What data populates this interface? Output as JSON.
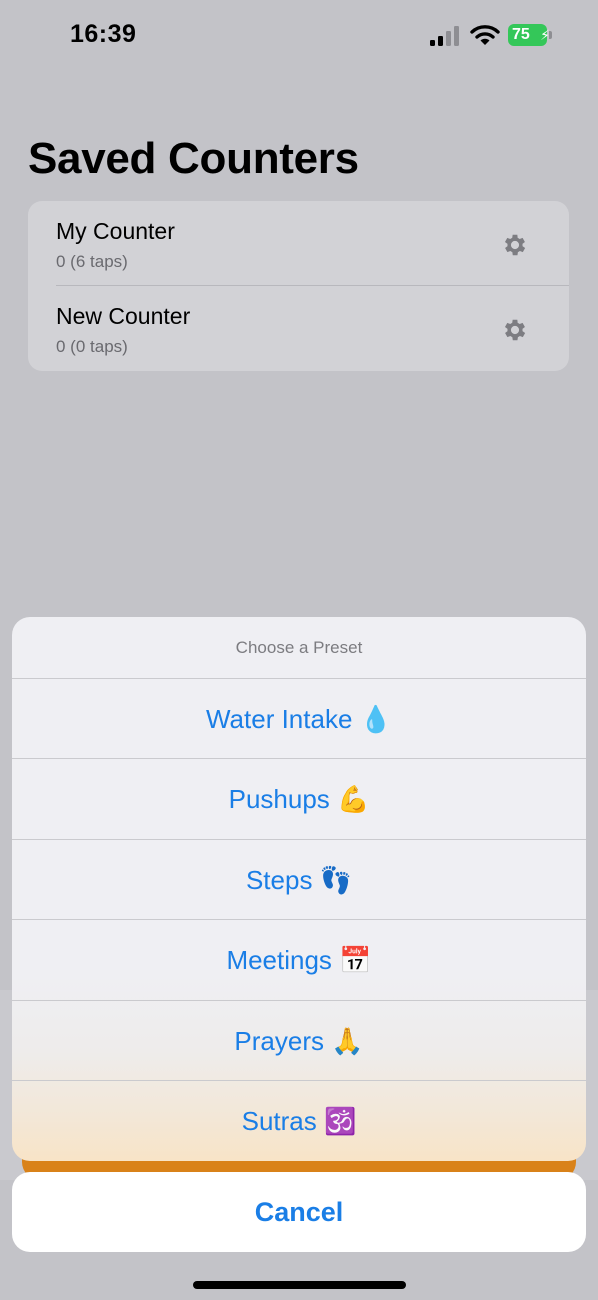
{
  "status_bar": {
    "time": "16:39",
    "battery_level": "75",
    "battery_charging_glyph": "⚡"
  },
  "page": {
    "title": "Saved Counters"
  },
  "counters": [
    {
      "name": "My Counter",
      "subtitle": "0 (6 taps)",
      "icon": "gear-icon"
    },
    {
      "name": "New Counter",
      "subtitle": "0 (0 taps)",
      "icon": "gear-icon"
    }
  ],
  "action_sheet": {
    "title": "Choose a Preset",
    "options": [
      {
        "label": "Water Intake 💧"
      },
      {
        "label": "Pushups 💪"
      },
      {
        "label": "Steps 👣"
      },
      {
        "label": "Meetings 📅"
      },
      {
        "label": "Prayers 🙏"
      },
      {
        "label": "Sutras 🕉️"
      }
    ],
    "cancel_label": "Cancel"
  },
  "colors": {
    "accent": "#1a7ee6",
    "battery_green": "#34c759",
    "dimmed_background": "#c3c3c8",
    "orange_button": "#d98219"
  }
}
